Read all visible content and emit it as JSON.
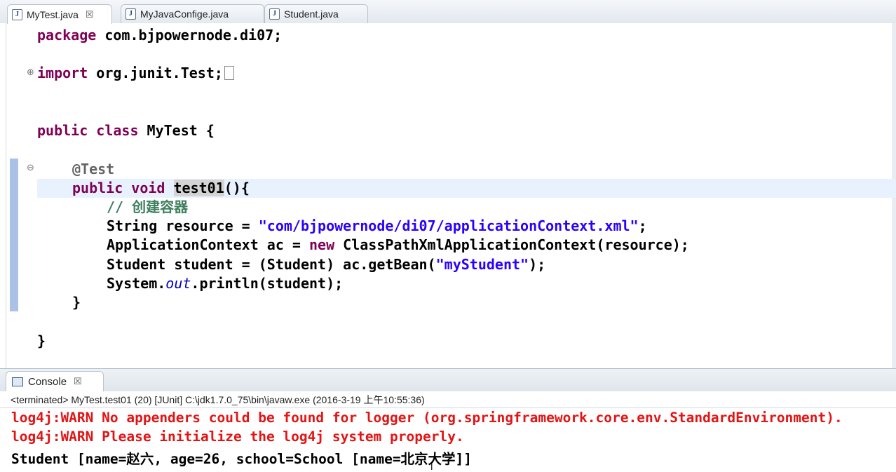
{
  "tabs": [
    {
      "label": "MyTest.java",
      "active": true,
      "closable": true
    },
    {
      "label": "MyJavaConfige.java",
      "active": false
    },
    {
      "label": "Student.java",
      "active": false
    }
  ],
  "editor": {
    "line_package": {
      "kw": "package",
      "rest": " com.bjpowernode.di07;"
    },
    "line_import": {
      "kw": "import",
      "rest": " org.junit.Test;"
    },
    "line_class": {
      "kw1": "public",
      "kw2": "class",
      "rest": " MyTest {"
    },
    "line_annotation": "@Test",
    "line_method": {
      "kw1": "public",
      "kw2": "void",
      "name": "test01",
      "rest": "(){"
    },
    "line_comment": "// 创建容器",
    "line_resource": {
      "pre": "String resource = ",
      "str": "\"com/bjpowernode/di07/applicationContext.xml\"",
      "post": ";"
    },
    "line_ctx": {
      "pre": "ApplicationContext ac = ",
      "kw": "new",
      "post": " ClassPathXmlApplicationContext(resource);"
    },
    "line_student": {
      "pre": "Student student = (Student) ac.getBean(",
      "str": "\"myStudent\"",
      "post": ");"
    },
    "line_print": {
      "pre": "System.",
      "field": "out",
      "post": ".println(student);"
    },
    "line_close_method": "}",
    "line_close_class": "}"
  },
  "console": {
    "tab_label": "Console",
    "status": "<terminated> MyTest.test01 (20) [JUnit] C:\\jdk1.7.0_75\\bin\\javaw.exe (2016-3-19 上午10:55:36)",
    "lines": [
      {
        "text": "log4j:WARN No appenders could be found for logger (org.springframework.core.env.StandardEnvironment).",
        "color": "#e31414"
      },
      {
        "text": "log4j:WARN Please initialize the log4j system properly.",
        "color": "#e31414"
      },
      {
        "text": "Student [name=赵六, age=26, school=School [name=北京大学]]",
        "color": "#000000"
      }
    ]
  }
}
